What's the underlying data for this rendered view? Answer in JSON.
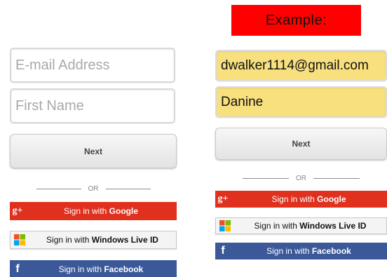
{
  "left_form": {
    "email_placeholder": "E-mail Address",
    "first_name_placeholder": "First Name",
    "next_label": "Next",
    "or_label": "OR",
    "google_prefix": "Sign in with ",
    "google_brand": "Google",
    "windows_prefix": "Sign in with ",
    "windows_brand": "Windows Live ID",
    "facebook_prefix": "Sign in with ",
    "facebook_brand": "Facebook"
  },
  "right_form": {
    "banner": "Example:",
    "email_value": "dwalker1114@gmail.com",
    "first_name_value": "Danine",
    "next_label": "Next",
    "or_label": "OR",
    "google_prefix": "Sign in with ",
    "google_brand": "Google",
    "windows_prefix": "Sign in with ",
    "windows_brand": "Windows Live ID",
    "facebook_prefix": "Sign in with ",
    "facebook_brand": "Facebook"
  },
  "icons": {
    "google": "google-plus-icon",
    "windows": "windows-logo-icon",
    "facebook": "facebook-icon",
    "google_glyph": "g+",
    "facebook_glyph": "f"
  },
  "colors": {
    "banner": "#ff0000",
    "filled_field": "#f8e07f",
    "google": "#e0301e",
    "facebook": "#3b5998",
    "windows_bg": "#f4f4f4",
    "placeholder": "#a9a9a9"
  }
}
